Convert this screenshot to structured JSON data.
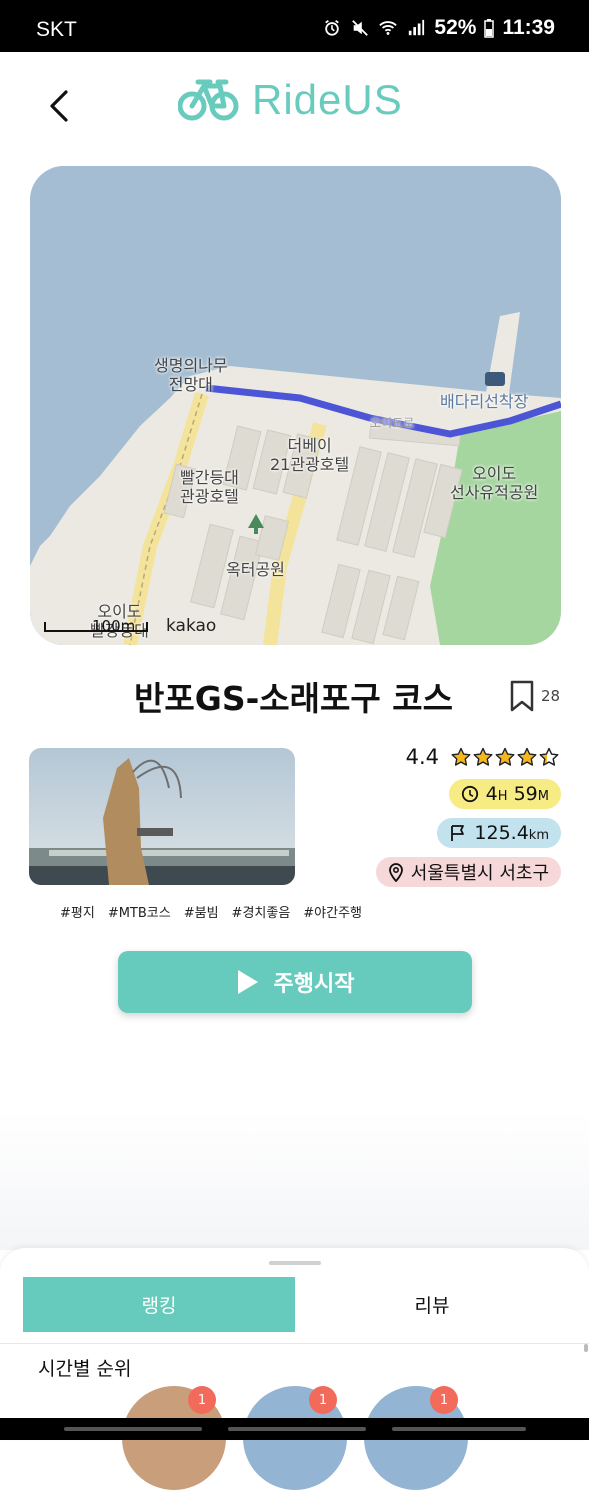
{
  "status_bar": {
    "carrier": "SKT",
    "battery": "52%",
    "time": "11:39"
  },
  "header": {
    "app_name": "RideUS",
    "brand_color": "#69cbbd"
  },
  "map": {
    "labels": {
      "observatory": "생명의나무\n전망대",
      "pier": "배다리선착장",
      "hotel_1": "더베이\n21관광호텔",
      "hotel_2": "빨간등대\n관광호텔",
      "park_1": "옥터공원",
      "park_2": "오이도\n선사유적공원",
      "road": "오이도로",
      "lighthouse": "오이도\n빨강등대"
    },
    "scale": "100m",
    "provider": "kakao",
    "route_color": "#4b55d6"
  },
  "course": {
    "title": "반포GS-소래포구 코스",
    "bookmark_count": "28",
    "rating": "4.4",
    "rating_value": 4.4,
    "rating_max": 5,
    "time_hours": "4",
    "time_hours_unit": "H",
    "time_minutes": "59",
    "time_minutes_unit": "M",
    "distance": "125.4",
    "distance_unit": "km",
    "location": "서울특별시 서초구",
    "tags": [
      "#평지",
      "#MTB코스",
      "#붐빔",
      "#경치좋음",
      "#야간주행"
    ]
  },
  "actions": {
    "start_label": "주행시작"
  },
  "bottom_sheet": {
    "tabs": [
      {
        "label": "랭킹",
        "active": true
      },
      {
        "label": "리뷰",
        "active": false
      }
    ],
    "section_title": "시간별 순위",
    "ranks": [
      "1",
      "1",
      "1"
    ]
  }
}
